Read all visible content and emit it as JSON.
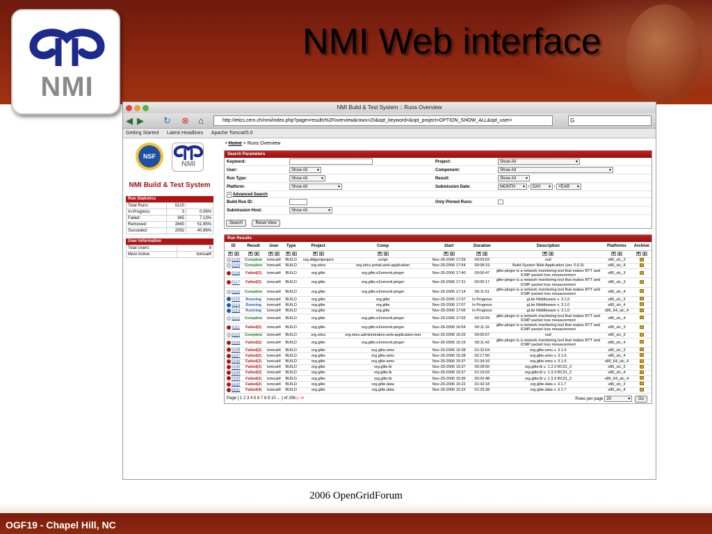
{
  "slide": {
    "title": "NMI Web interface",
    "logo_text": "NMI",
    "footer_left": "OGF19 - Chapel Hill, NC",
    "footer_center": "2006 OpenGridForum"
  },
  "browser": {
    "window_title": "NMI Build & Test System :: Runs Overview",
    "url": "http://etics.cern.ch/nmi/index.php?page=results%2Foverview&rows=20&opt_keyword=&opt_project=OPTION_SHOW_ALL&opt_user=",
    "search_value": "G",
    "bookmarks": [
      "Getting Started",
      "Latest Headlines",
      "Apache Tomcat/5.0"
    ]
  },
  "left": {
    "nsf_label": "NSF",
    "nmi_label": "NMI",
    "title": "NMI Build & Test System",
    "run_stats_header": "Run Statistics",
    "run_stats": [
      {
        "label": "Total Runs:",
        "count": "5120",
        "pct": ""
      },
      {
        "label": "In-Progress:",
        "count": "3",
        "pct": "0.06%"
      },
      {
        "label": "Failed:",
        "count": "365",
        "pct": "7.13%"
      },
      {
        "label": "Removed:",
        "count": "2660",
        "pct": "51.95%"
      },
      {
        "label": "Succeded:",
        "count": "2092",
        "pct": "40.86%"
      }
    ],
    "user_info_header": "User Information",
    "user_info": [
      {
        "label": "Total Users:",
        "value": "8"
      },
      {
        "label": "Most Active:",
        "value": "tomcat4"
      }
    ]
  },
  "main": {
    "crumb_home": "Home",
    "crumb_rest": " > Runs Overview",
    "search_header": "Search Parameters",
    "labels": {
      "keyword": "Keyword:",
      "user": "User:",
      "run_type": "Run Type:",
      "platform": "Platform:",
      "advanced": "Advanced Search",
      "build_run_id": "Build Run ID:",
      "submission_host": "Submission Host:",
      "project": "Project:",
      "component": "Component:",
      "result": "Result:",
      "submission_date": "Submission Date:",
      "only_pinned": "Only Pinned Runs:"
    },
    "values": {
      "show_all": "Show All",
      "month": "MONTH",
      "day": "DAY",
      "year": "YEAR",
      "slash": "/"
    },
    "buttons": {
      "search": "Search",
      "reset": "Reset View"
    },
    "results_header": "Run Results",
    "columns": [
      "ID",
      "Result",
      "User",
      "Type",
      "Project",
      "Comp",
      "Start",
      "Duration",
      "Description",
      "Platforms",
      "Archive"
    ],
    "rows": [
      {
        "id": "5120",
        "result": "Complete",
        "status": "c",
        "user": "tomcat4",
        "type": "BUILD",
        "project": "org.diligentproject",
        "comp": "script",
        "start": "Nov-29-2006 17:59",
        "duration": "00:09:02",
        "desc": "null",
        "platform": "x86_slc_3"
      },
      {
        "id": "5119",
        "result": "Complete",
        "status": "c",
        "user": "tomcat4",
        "type": "BUILD",
        "project": "org.etics",
        "comp": "org.etics.portal.web-application",
        "start": "Nov-29-2006 17:54",
        "duration": "00:08:19",
        "desc": "Build System Web Application (ver. 0.6.0)",
        "platform": "x86_slc_4"
      },
      {
        "id": "5118",
        "result": "Failed(2)",
        "status": "f",
        "user": "tomcat4",
        "type": "BUILD",
        "project": "org.glite",
        "comp": "org.glite.e2emonit.pinger",
        "start": "Nov-29-2006 17:40",
        "duration": "00:06:47",
        "desc": "glite-pinger is a network monitoring tool that makes RTT and ICMP packet loss measurement",
        "platform": "x86_slc_3"
      },
      {
        "id": "5117",
        "result": "Failed(2)",
        "status": "f",
        "user": "tomcat4",
        "type": "BUILD",
        "project": "org.glite",
        "comp": "org.glite.e2emonit.pinger",
        "start": "Nov-29-2006 17:31",
        "duration": "00:05:17",
        "desc": "glite-pinger is a network monitoring tool that makes RTT and ICMP packet loss measurement",
        "platform": "x86_slc_3"
      },
      {
        "id": "5116",
        "result": "Complete",
        "status": "c",
        "user": "tomcat4",
        "type": "BUILD",
        "project": "org.glite",
        "comp": "org.glite.e2emonit.pinger",
        "start": "Nov-29-2006 17:14",
        "duration": "00:11:51",
        "desc": "glite-pinger is a network monitoring tool that makes RTT and ICMP packet loss measurement",
        "platform": "x86_slc_4"
      },
      {
        "id": "5115",
        "result": "Running",
        "status": "r",
        "user": "tomcat4",
        "type": "BUILD",
        "project": "org.glite",
        "comp": "org.glite",
        "start": "Nov-29-2006 17:07",
        "duration": "In Progress",
        "desc": "gLite Middleware v. 3.1.0",
        "platform": "x86_slc_3"
      },
      {
        "id": "5114",
        "result": "Running",
        "status": "r",
        "user": "tomcat4",
        "type": "BUILD",
        "project": "org.glite",
        "comp": "org.glite",
        "start": "Nov-29-2006 17:07",
        "duration": "In Progress",
        "desc": "gLite Middleware v. 3.1.0",
        "platform": "x86_slc_4"
      },
      {
        "id": "5113",
        "result": "Running",
        "status": "r",
        "user": "tomcat4",
        "type": "BUILD",
        "project": "org.glite",
        "comp": "org.glite",
        "start": "Nov-29-2006 17:06",
        "duration": "In Progress",
        "desc": "gLite Middleware v. 3.1.0",
        "platform": "x86_64_slc_4"
      },
      {
        "id": "5112",
        "result": "Complete",
        "status": "c",
        "user": "tomcat4",
        "type": "BUILD",
        "project": "org.glite",
        "comp": "org.glite.e2emonit.pinger",
        "start": "Nov-29-2006 17:03",
        "duration": "00:16:59",
        "desc": "glite-pinger is a network monitoring tool that makes RTT and ICMP packet loss measurement",
        "platform": "x86_slc_4"
      },
      {
        "id": "5111",
        "result": "Failed(2)",
        "status": "f",
        "user": "tomcat4",
        "type": "BUILD",
        "project": "org.glite",
        "comp": "org.glite.e2emonit.pinger",
        "start": "Nov-29-2006 16:54",
        "duration": "00:11:16",
        "desc": "glite-pinger is a network monitoring tool that makes RTT and ICMP packet loss measurement",
        "platform": "x86_slc_3"
      },
      {
        "id": "5110",
        "result": "Complete",
        "status": "c",
        "user": "tomcat4",
        "type": "BUILD",
        "project": "org.etics",
        "comp": "org.etics.administration.web-application-test",
        "start": "Nov-29-2006 16:25",
        "duration": "00:05:57",
        "desc": "null",
        "platform": "x86_slc_3"
      },
      {
        "id": "5109",
        "result": "Failed(2)",
        "status": "f",
        "user": "tomcat4",
        "type": "BUILD",
        "project": "org.glite",
        "comp": "org.glite.e2emonit.pinger",
        "start": "Nov-29-2006 16:15",
        "duration": "00:11:42",
        "desc": "glite-pinger is a network monitoring tool that makes RTT and ICMP packet loss measurement",
        "platform": "x86_slc_4"
      },
      {
        "id": "5108",
        "result": "Failed(2)",
        "status": "f",
        "user": "tomcat4",
        "type": "BUILD",
        "project": "org.glite",
        "comp": "org.glite.wms",
        "start": "Nov-29-2006 15:38",
        "duration": "01:32:54",
        "desc": "org.glite.wms v. 3.1.6",
        "platform": "x86_slc_3"
      },
      {
        "id": "5107",
        "result": "Failed(2)",
        "status": "f",
        "user": "tomcat4",
        "type": "BUILD",
        "project": "org.glite",
        "comp": "org.glite.wms",
        "start": "Nov-29-2006 15:38",
        "duration": "02:17:50",
        "desc": "org.glite.wms v. 3.1.6",
        "platform": "x86_slc_4"
      },
      {
        "id": "5106",
        "result": "Failed(2)",
        "status": "f",
        "user": "tomcat4",
        "type": "BUILD",
        "project": "org.glite",
        "comp": "org.glite.wms",
        "start": "Nov-29-2006 15:37",
        "duration": "01:34:16",
        "desc": "org.glite.wms v. 3.1.6",
        "platform": "x86_64_slc_4"
      },
      {
        "id": "5105",
        "result": "Failed(2)",
        "status": "f",
        "user": "tomcat4",
        "type": "BUILD",
        "project": "org.glite",
        "comp": "org.glite.lb",
        "start": "Nov-29-2006 15:37",
        "duration": "00:28:50",
        "desc": "org.glite.lb v. 1.3.3 RC31_2",
        "platform": "x86_slc_3"
      },
      {
        "id": "5104",
        "result": "Failed(2)",
        "status": "f",
        "user": "tomcat4",
        "type": "BUILD",
        "project": "org.glite",
        "comp": "org.glite.lb",
        "start": "Nov-29-2006 15:37",
        "duration": "01:16:03",
        "desc": "org.glite.lb v. 1.3.3 RC31_2",
        "platform": "x86_slc_4"
      },
      {
        "id": "5103",
        "result": "Failed(2)",
        "status": "f",
        "user": "tomcat4",
        "type": "BUILD",
        "project": "org.glite",
        "comp": "org.glite.lb",
        "start": "Nov-29-2006 15:36",
        "duration": "00:20:48",
        "desc": "org.glite.lb v. 1.3.3 RC31_2",
        "platform": "x86_64_slc_4"
      },
      {
        "id": "5102",
        "result": "Failed(2)",
        "status": "f",
        "user": "tomcat4",
        "type": "BUILD",
        "project": "org.glite",
        "comp": "org.glite.data",
        "start": "Nov-29-2006 15:22",
        "duration": "01:42:18",
        "desc": "org.glite.data v. 3.1.7",
        "platform": "x86_slc_3"
      },
      {
        "id": "5101",
        "result": "Failed(4)",
        "status": "f",
        "user": "tomcat4",
        "type": "BUILD",
        "project": "org.glite",
        "comp": "org.glite.data",
        "start": "Nov-29-2006 15:22",
        "duration": "01:29:28",
        "desc": "org.glite.data v. 3.1.7",
        "platform": "x86_slc_4"
      }
    ],
    "pager": {
      "text": "Page [ 1 2 3 4 5 6 7 8 9 10 ... ] of 256",
      "rows_label": "Rows per page",
      "rows_value": "20",
      "go": "Go"
    }
  },
  "colors": {
    "band": "#8c2610",
    "header_red": "#b01515",
    "complete": "#1a7a1a",
    "failed": "#b01010",
    "running": "#1a5aa8"
  }
}
